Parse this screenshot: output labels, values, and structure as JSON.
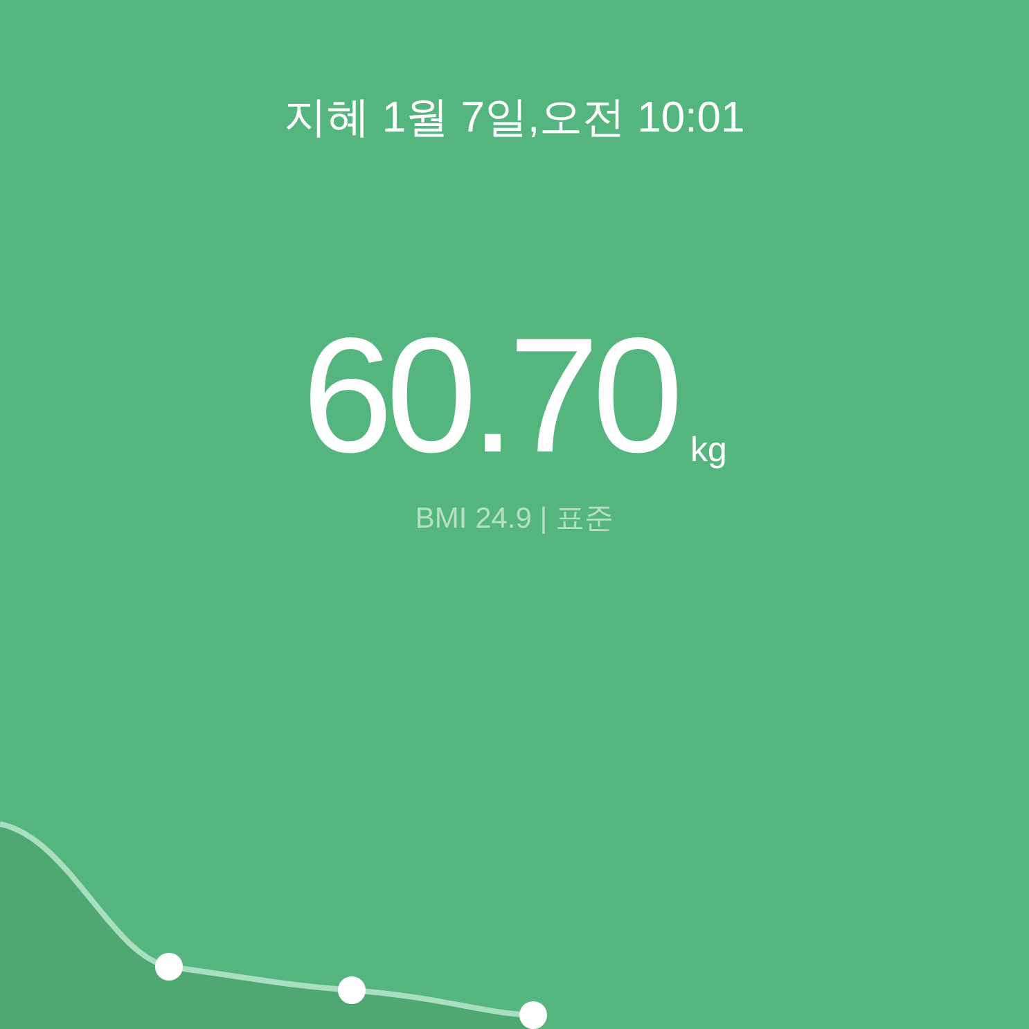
{
  "header": {
    "title": "지혜 1월 7일,오전 10:01"
  },
  "weight": {
    "value": "60.70",
    "unit": "kg",
    "bmi": "BMI 24.9 | 표준"
  }
}
